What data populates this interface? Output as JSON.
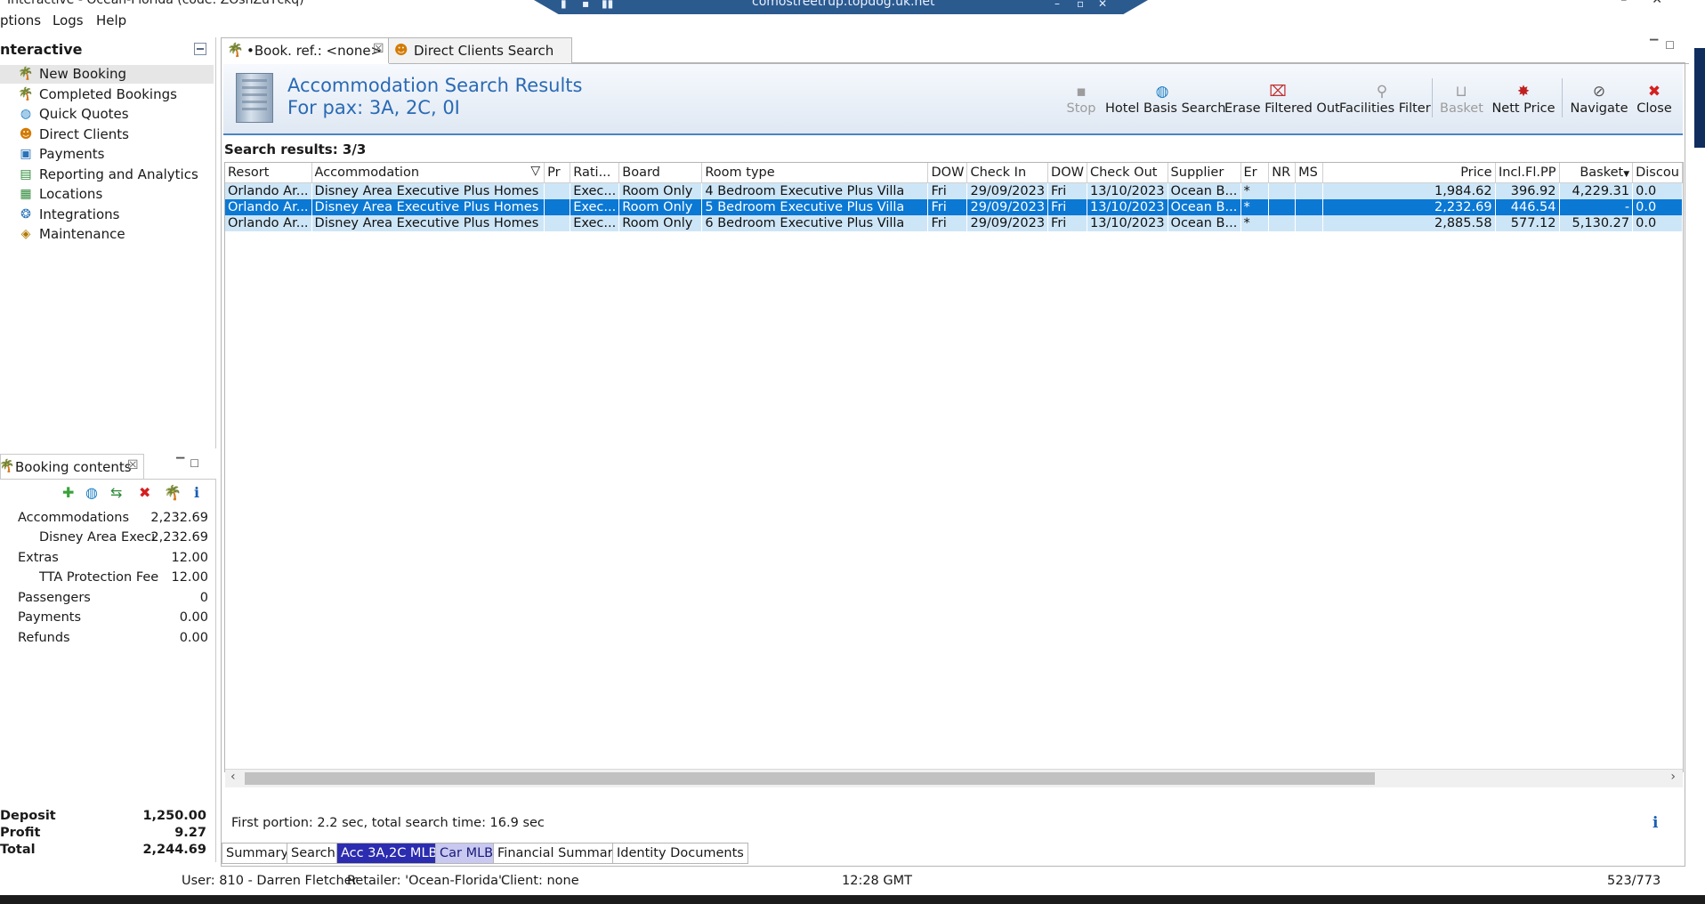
{
  "window": {
    "title": "Interactive - Ocean-Florida (code: ZOshZuYckq)",
    "remote_host": "comostreetrup.topdog.uk.net"
  },
  "menubar": [
    "ptions",
    "Logs",
    "Help"
  ],
  "nav": {
    "title": "nteractive",
    "items": [
      {
        "label": "New Booking",
        "icon": "palm-tree-icon",
        "selected": true
      },
      {
        "label": "Completed Bookings",
        "icon": "palm-tree-stack-icon"
      },
      {
        "label": "Quick Quotes",
        "icon": "globe-clock-icon"
      },
      {
        "label": "Direct Clients",
        "icon": "person-icon"
      },
      {
        "label": "Payments",
        "icon": "payments-icon"
      },
      {
        "label": "Reporting and Analytics",
        "icon": "report-icon"
      },
      {
        "label": "Locations",
        "icon": "map-icon"
      },
      {
        "label": "Integrations",
        "icon": "integrations-icon"
      },
      {
        "label": "Maintenance",
        "icon": "maintenance-icon"
      }
    ]
  },
  "booking_contents": {
    "tab_label": "Booking contents",
    "rows": [
      {
        "label": "Accommodations",
        "value": "2,232.69",
        "indent": 1
      },
      {
        "label": "Disney Area Executive Plus Homes",
        "value": "2,232.69",
        "indent": 2
      },
      {
        "label": "Extras",
        "value": "12.00",
        "indent": 1
      },
      {
        "label": "TTA Protection Fee",
        "value": "12.00",
        "indent": 2
      },
      {
        "label": "Passengers",
        "value": "0",
        "indent": 1
      },
      {
        "label": "Payments",
        "value": "0.00",
        "indent": 1
      },
      {
        "label": "Refunds",
        "value": "0.00",
        "indent": 1
      }
    ],
    "summary": [
      {
        "label": "Deposit",
        "value": "1,250.00"
      },
      {
        "label": "Profit",
        "value": "9.27"
      },
      {
        "label": "Total",
        "value": "2,244.69"
      }
    ]
  },
  "tabs": [
    {
      "label": "•Book. ref.: <none>",
      "active": true,
      "closable": true
    },
    {
      "label": "Direct Clients Search",
      "active": false
    }
  ],
  "header": {
    "title": "Accommodation Search Results",
    "subtitle": "For pax: 3A, 2C, 0I"
  },
  "toolbar": [
    {
      "label": "Stop",
      "icon": "stop-icon",
      "disabled": true
    },
    {
      "label": "Hotel Basis Search",
      "icon": "globe-search-icon"
    },
    {
      "label": "Erase Filtered Out",
      "icon": "erase-filter-icon"
    },
    {
      "label": "Facilities Filter",
      "icon": "filter-icon"
    },
    {
      "label": "Basket",
      "icon": "basket-icon",
      "disabled": true
    },
    {
      "label": "Nett Price",
      "icon": "nett-price-icon"
    },
    {
      "label": "Navigate",
      "icon": "navigate-icon"
    },
    {
      "label": "Close",
      "icon": "close-icon"
    }
  ],
  "results": {
    "count_label": "Search results: 3/3",
    "columns": [
      "Resort",
      "Accommodation",
      "Pr",
      "Rati...",
      "Board",
      "Room type",
      "DOW",
      "Check In",
      "DOW",
      "Check Out",
      "Supplier",
      "Er",
      "NR",
      "MS",
      "Price",
      "Incl.Fl.PP",
      "Basket",
      "Discou"
    ],
    "rows": [
      {
        "cells": [
          "Orlando Ar...",
          "Disney Area Executive Plus Homes",
          "",
          "Exec...",
          "Room Only",
          "4 Bedroom Executive Plus Villa",
          "Fri",
          "29/09/2023",
          "Fri",
          "13/10/2023",
          "Ocean B...",
          "*",
          "",
          "",
          "1,984.62",
          "396.92",
          "4,229.31",
          "0.0"
        ],
        "state": "light"
      },
      {
        "cells": [
          "Orlando Ar...",
          "Disney Area Executive Plus Homes",
          "",
          "Exec...",
          "Room Only",
          "5 Bedroom Executive Plus Villa",
          "Fri",
          "29/09/2023",
          "Fri",
          "13/10/2023",
          "Ocean B...",
          "*",
          "",
          "",
          "2,232.69",
          "446.54",
          "-",
          "0.0"
        ],
        "state": "selected"
      },
      {
        "cells": [
          "Orlando Ar...",
          "Disney Area Executive Plus Homes",
          "",
          "Exec...",
          "Room Only",
          "6 Bedroom Executive Plus Villa",
          "Fri",
          "29/09/2023",
          "Fri",
          "13/10/2023",
          "Ocean B...",
          "*",
          "",
          "",
          "2,885.58",
          "577.12",
          "5,130.27",
          "0.0"
        ],
        "state": "light"
      }
    ]
  },
  "status_line": "First portion: 2.2 sec, total search time: 16.9 sec",
  "bottom_tabs": [
    "Summary",
    "Search",
    "Acc 3A,2C MLB",
    "Car MLB",
    "Financial Summary",
    "Identity Documents"
  ],
  "footer": {
    "user": "User: 810 - Darren Fletcher",
    "retailer": "Retailer: 'Ocean-Florida'",
    "client": "Client: none",
    "time": "12:28 GMT",
    "memory": "523/773"
  },
  "colors": {
    "accent": "#2a6ab4",
    "selected_row": "#0b78d4",
    "highlight_row": "#cde6f7",
    "acc_tab": "#2c2cb0",
    "car_tab": "#c8c8f0"
  }
}
